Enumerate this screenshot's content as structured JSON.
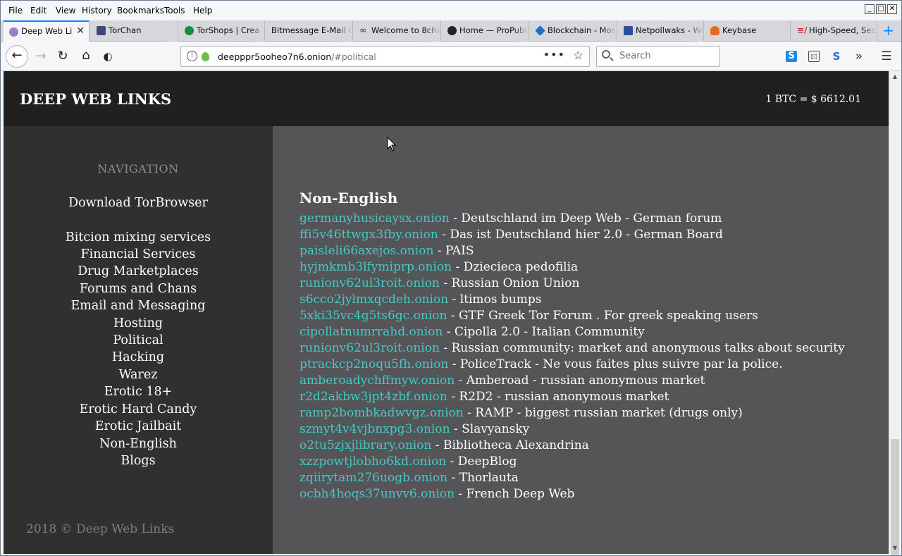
{
  "menu": [
    "File",
    "Edit",
    "View",
    "History",
    "Bookmarks",
    "Tools",
    "Help"
  ],
  "tabs": [
    {
      "label": "Deep Web Li",
      "icon_color": "#9b7fc7",
      "active": true
    },
    {
      "label": "TorChan",
      "icon_color": "#3d4a77"
    },
    {
      "label": "TorShops | Crea",
      "icon_color": "#1c8a3d"
    },
    {
      "label": "Bitmessage E-Mail Ga",
      "icon_color": "#d7d7db"
    },
    {
      "label": "Welcome to 8cha",
      "icon_color": "#444"
    },
    {
      "label": "Home — ProPubli",
      "icon_color": "#222"
    },
    {
      "label": "Blockchain - Most",
      "icon_color": "#1e6fc7"
    },
    {
      "label": "Netpollwaks - We",
      "icon_color": "#2a4f9c"
    },
    {
      "label": "Keybase",
      "icon_color": "#e56b20"
    },
    {
      "label": "High-Speed, Sec",
      "icon_color": "#d32333"
    }
  ],
  "urlbar": {
    "host": "deepppr5ooheo7n6.onion",
    "path": "/#political"
  },
  "search": {
    "placeholder": "Search"
  },
  "site": {
    "title": "DEEP WEB LINKS",
    "btc_price": "1 BTC = $ 6612.01",
    "nav_heading": "NAVIGATION",
    "nav": [
      "Download TorBrowser",
      "Bitcion mixing services",
      "Financial Services",
      "Drug Marketplaces",
      "Forums and Chans",
      "Email and Messaging",
      "Hosting",
      "Political",
      "Hacking",
      "Warez",
      "Erotic 18+",
      "Erotic Hard Candy",
      "Erotic Jailbait",
      "Non-English",
      "Blogs"
    ],
    "footer": "2018 © Deep Web Links",
    "section_title": "Non-English",
    "links": [
      {
        "addr": "germanyhusicaysx.onion",
        "desc": " - Deutschland im Deep Web - German forum"
      },
      {
        "addr": "ffi5v46ttwgx3fby.onion",
        "desc": " - Das ist Deutschland hier 2.0 - German Board"
      },
      {
        "addr": "paisleli66axejos.onion",
        "desc": " - PAIS"
      },
      {
        "addr": "hyjmkmb3lfymiprp.onion",
        "desc": " - Dziecieca pedofilia"
      },
      {
        "addr": "runionv62ul3roit.onion",
        "desc": " - Russian Onion Union"
      },
      {
        "addr": "s6cco2jylmxqcdeh.onion",
        "desc": " - ltimos bumps"
      },
      {
        "addr": "5xki35vc4g5ts6gc.onion",
        "desc": " - GTF Greek Tor Forum . For greek speaking users"
      },
      {
        "addr": "cipollatnumrrahd.onion",
        "desc": " - Cipolla 2.0 - Italian Community"
      },
      {
        "addr": "runionv62ul3roit.onion",
        "desc": " - Russian community: market and anonymous talks about security"
      },
      {
        "addr": "ptrackcp2noqu5fh.onion",
        "desc": " - PoliceTrack - Ne vous faites plus suivre par la police."
      },
      {
        "addr": "amberoadychffmyw.onion",
        "desc": " - Amberoad - russian anonymous market"
      },
      {
        "addr": "r2d2akbw3jpt4zbf.onion",
        "desc": " - R2D2 - russian anonymous market"
      },
      {
        "addr": "ramp2bombkadwvgz.onion",
        "desc": " - RAMP - biggest russian market (drugs only)"
      },
      {
        "addr": "szmyt4v4vjbnxpg3.onion",
        "desc": " - Slavyansky"
      },
      {
        "addr": "o2tu5zjxjlibrary.onion",
        "desc": " - Bibliotheca Alexandrina"
      },
      {
        "addr": "xzzpowtjlobho6kd.onion",
        "desc": " - DeepBlog"
      },
      {
        "addr": "zqiirytam276uogb.onion",
        "desc": " - Thorlauta"
      },
      {
        "addr": "ocbh4hoqs37unvv6.onion",
        "desc": " - French Deep Web"
      }
    ]
  },
  "colors": {
    "link": "#44c9c8",
    "sidebar": "#303030",
    "header": "#202020",
    "main": "#555557",
    "accent": "#0a84ff"
  }
}
